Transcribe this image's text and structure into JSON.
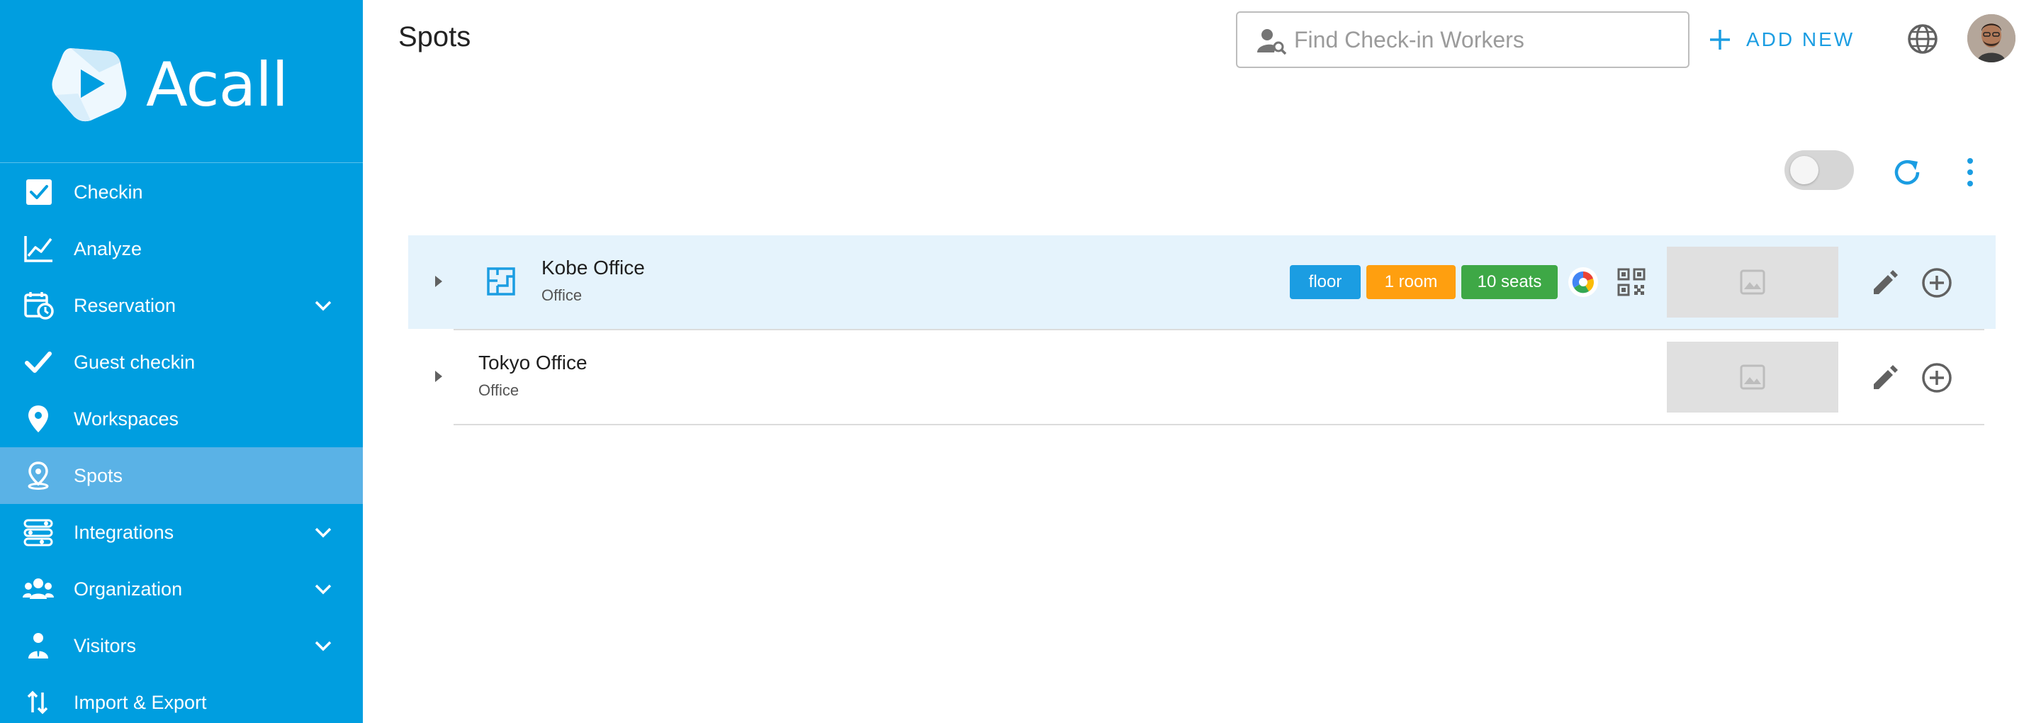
{
  "sidebar": {
    "brand": "Acall",
    "items": [
      {
        "label": "Checkin",
        "icon": "checkbox-icon",
        "chevron": false,
        "active": false
      },
      {
        "label": "Analyze",
        "icon": "chart-line-icon",
        "chevron": false,
        "active": false
      },
      {
        "label": "Reservation",
        "icon": "calendar-clock-icon",
        "chevron": true,
        "active": false
      },
      {
        "label": "Guest checkin",
        "icon": "checkmark-icon",
        "chevron": false,
        "active": false
      },
      {
        "label": "Workspaces",
        "icon": "map-pin-icon",
        "chevron": false,
        "active": false
      },
      {
        "label": "Spots",
        "icon": "spot-pin-icon",
        "chevron": false,
        "active": true
      },
      {
        "label": "Integrations",
        "icon": "integrations-icon",
        "chevron": true,
        "active": false
      },
      {
        "label": "Organization",
        "icon": "people-icon",
        "chevron": true,
        "active": false
      },
      {
        "label": "Visitors",
        "icon": "visitor-icon",
        "chevron": true,
        "active": false
      },
      {
        "label": "Import & Export",
        "icon": "import-export-icon",
        "chevron": false,
        "active": false
      }
    ]
  },
  "header": {
    "title": "Spots",
    "search_placeholder": "Find Check-in Workers",
    "add_new_label": "ADD NEW"
  },
  "toolbar": {
    "toggle_on": false
  },
  "spots": [
    {
      "name": "Kobe Office",
      "type": "Office",
      "tags": [
        {
          "label": "floor",
          "color": "#1b9de2"
        },
        {
          "label": "1 room",
          "color": "#ff9f0f"
        },
        {
          "label": "10 seats",
          "color": "#3ea846"
        }
      ]
    },
    {
      "name": "Tokyo Office",
      "type": "Office",
      "tags": []
    }
  ],
  "colors": {
    "sidebar": "#009ee0",
    "sidebar_active": "#5ab2e6",
    "accent": "#1b9de2",
    "row_highlight": "#e5f3fc"
  }
}
